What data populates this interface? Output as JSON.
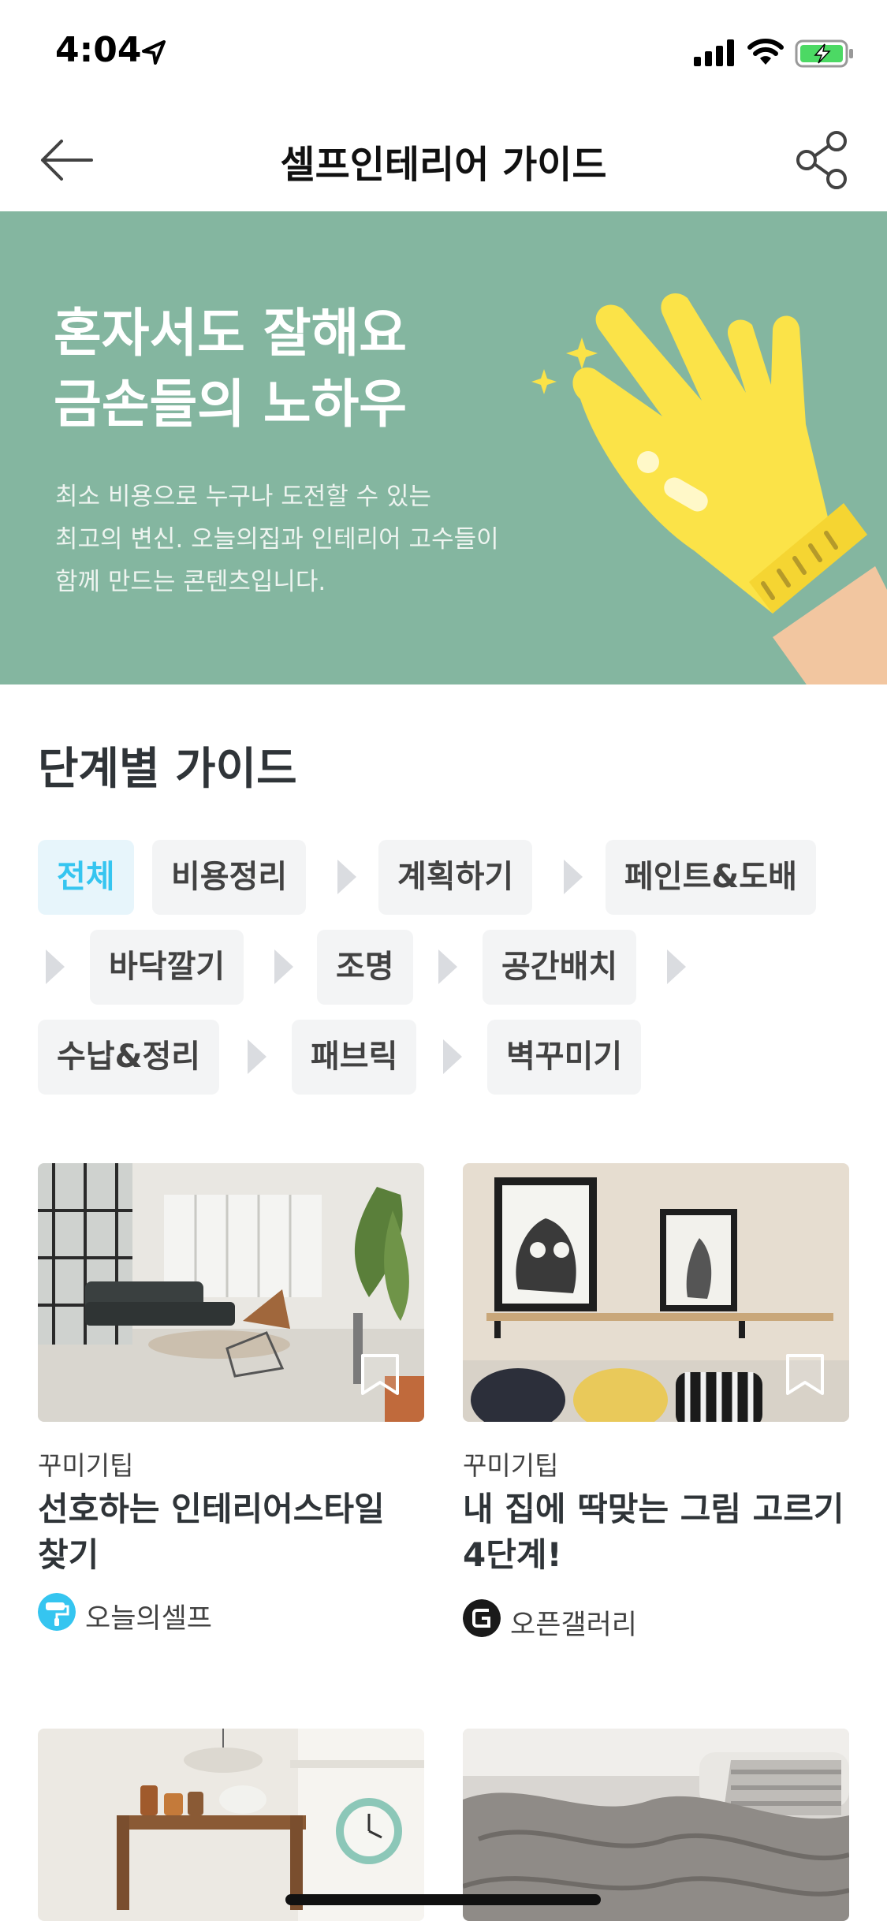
{
  "status_bar": {
    "time": "4:04"
  },
  "nav": {
    "title": "셀프인테리어 가이드"
  },
  "hero": {
    "headline": [
      "혼자서도 잘해요",
      "금손들의 노하우"
    ],
    "description": [
      "최소 비용으로 누구나 도전할 수 있는",
      "최고의 변신. 오늘의집과 인테리어 고수들이",
      "함께 만드는 콘텐츠입니다."
    ],
    "background_color": "#84b6a0"
  },
  "section": {
    "title": "단계별 가이드"
  },
  "chips": [
    {
      "label": "전체",
      "active": true
    },
    {
      "label": "비용정리"
    },
    {
      "label": "계획하기"
    },
    {
      "label": "페인트&도배"
    },
    {
      "label": "바닥깔기"
    },
    {
      "label": "조명"
    },
    {
      "label": "공간배치"
    },
    {
      "label": "수납&정리"
    },
    {
      "label": "패브릭"
    },
    {
      "label": "벽꾸미기"
    }
  ],
  "cards": [
    {
      "category": "꾸미기팁",
      "title": "선호하는 인테리어스타일 찾기",
      "author": "오늘의셀프"
    },
    {
      "category": "꾸미기팁",
      "title": "내 집에 딱맞는 그림 고르기 4단계!",
      "author": "오픈갤러리"
    }
  ],
  "colors": {
    "accent": "#35c5f0",
    "chip_bg": "#f3f4f5",
    "hero_bg": "#84b6a0"
  }
}
